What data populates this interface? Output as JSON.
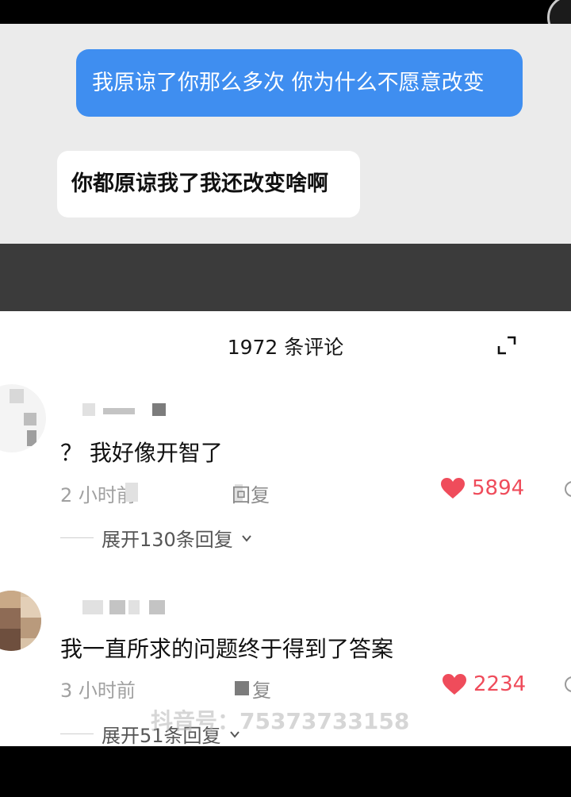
{
  "chat": {
    "message_sent": "我原谅了你那么多次 你为什么不愿意改变",
    "message_received": "你都原谅我了我还改变啥啊"
  },
  "comments_panel": {
    "title": "1972 条评论",
    "expand_icon": "expand-icon"
  },
  "comments": [
    {
      "text": "？ 我好像开智了",
      "time": "2 小时前",
      "reply_label": "回复",
      "likes": "5894",
      "expand_replies": "展开130条回复"
    },
    {
      "text": "我一直所求的问题终于得到了答案",
      "time": "3 小时前",
      "reply_label": "复",
      "likes": "2234",
      "expand_replies": "展开51条回复"
    }
  ],
  "watermark": "抖音号：75373733158",
  "colors": {
    "sent_bubble": "#3f8ef0",
    "like_red": "#ef4c5b",
    "chat_bg": "#ebebeb"
  }
}
